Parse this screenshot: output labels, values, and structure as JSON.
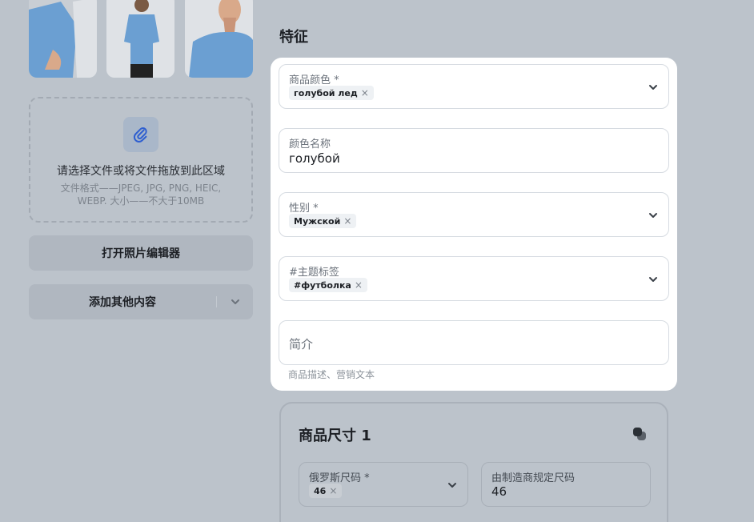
{
  "left": {
    "upload": {
      "title": "请选择文件或将文件拖放到此区域",
      "hint": "文件格式——JPEG, JPG, PNG, HEIC, WEBP. 大小——不大于10MB"
    },
    "photo_editor_button": "打开照片编辑器",
    "add_more_button": "添加其他内容"
  },
  "section_title": "特征",
  "fields": {
    "color": {
      "label": "商品颜色 *",
      "chip": "голубой лед",
      "chip_remove": "×"
    },
    "color_name": {
      "label": "颜色名称",
      "value": "голубой"
    },
    "gender": {
      "label": "性别 *",
      "chip": "Мужской",
      "chip_remove": "×"
    },
    "hashtags": {
      "label": "#主题标签",
      "chip": "#футболка",
      "chip_remove": "×"
    },
    "description": {
      "placeholder": "简介",
      "hint": "商品描述、营销文本"
    }
  },
  "size_section": {
    "title": "商品尺寸 1",
    "ru_size": {
      "label": "俄罗斯尺码 *",
      "chip": "46",
      "chip_remove": "×"
    },
    "maker_size": {
      "label": "由制造商规定尺码",
      "value": "46"
    }
  },
  "colors": {
    "background": "#bcc3cb",
    "card": "#ffffff",
    "accent_clip": "#2f5fd0",
    "shirt": "#6b9fd2"
  },
  "icons": [
    "paperclip-icon",
    "chevron-down-icon",
    "close-icon",
    "copy-icon"
  ]
}
